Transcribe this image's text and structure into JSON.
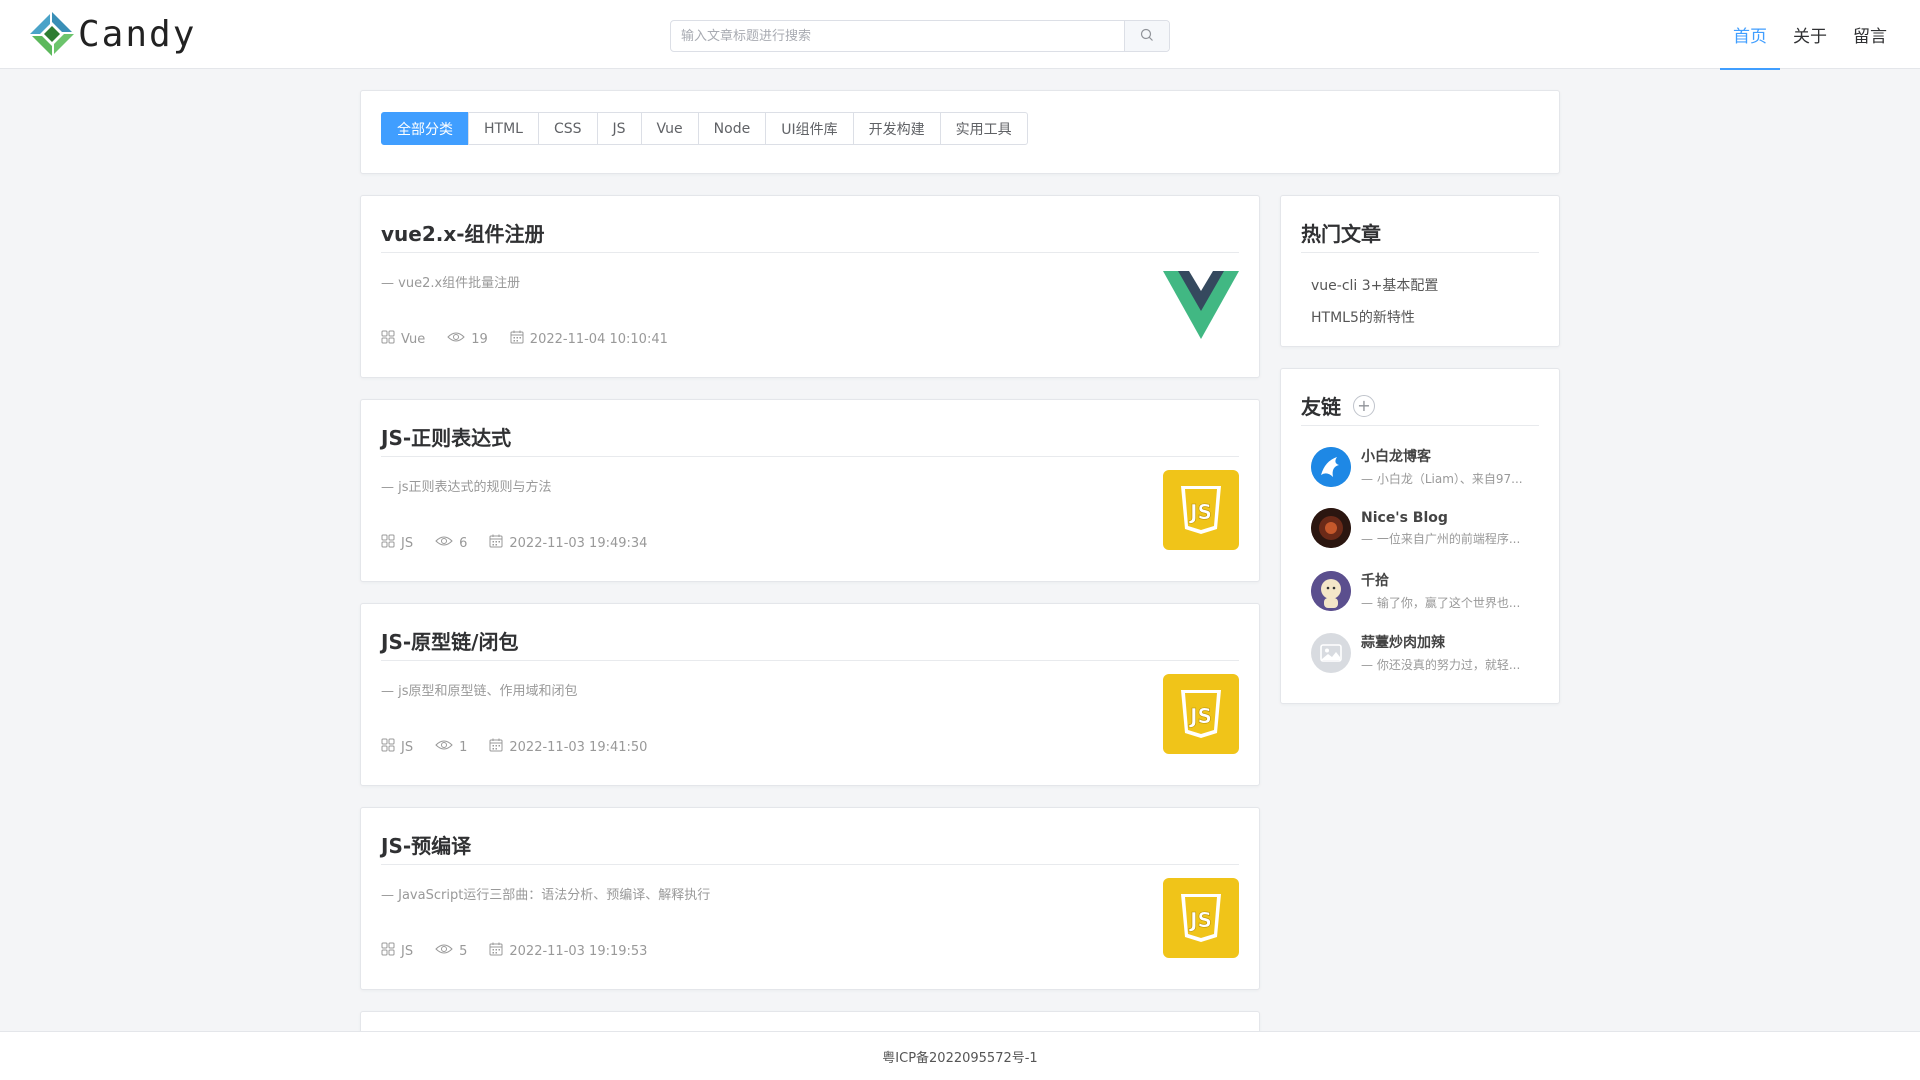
{
  "header": {
    "logo_text": "Candy",
    "search_placeholder": "输入文章标题进行搜索",
    "nav": [
      "首页",
      "关于",
      "留言"
    ]
  },
  "categories": [
    {
      "label": "全部分类",
      "active": true
    },
    {
      "label": "HTML"
    },
    {
      "label": "CSS"
    },
    {
      "label": "JS"
    },
    {
      "label": "Vue"
    },
    {
      "label": "Node"
    },
    {
      "label": "UI组件库"
    },
    {
      "label": "开发构建"
    },
    {
      "label": "实用工具"
    }
  ],
  "articles": [
    {
      "title": "vue2.x-组件注册",
      "desc": "— vue2.x组件批量注册",
      "category": "Vue",
      "views": "19",
      "date": "2022-11-04 10:10:41",
      "thumb": "vue-logo-icon"
    },
    {
      "title": "JS-正则表达式",
      "desc": "— js正则表达式的规则与方法",
      "category": "JS",
      "views": "6",
      "date": "2022-11-03 19:49:34",
      "thumb": "js-logo-icon"
    },
    {
      "title": "JS-原型链/闭包",
      "desc": "— js原型和原型链、作用域和闭包",
      "category": "JS",
      "views": "1",
      "date": "2022-11-03 19:41:50",
      "thumb": "js-logo-icon"
    },
    {
      "title": "JS-预编译",
      "desc": "— JavaScript运行三部曲：语法分析、预编译、解释执行",
      "category": "JS",
      "views": "5",
      "date": "2022-11-03 19:19:53",
      "thumb": "js-logo-icon"
    }
  ],
  "hot": {
    "title": "热门文章",
    "items": [
      "vue-cli 3+基本配置",
      "HTML5的新特性"
    ]
  },
  "friends": {
    "title": "友链",
    "plus": "+",
    "items": [
      {
        "name": "小白龙博客",
        "desc": "— 小白龙（Liam）、来自97..."
      },
      {
        "name": "Nice's Blog",
        "desc": "— 一位来自广州的前端程序..."
      },
      {
        "name": "千拾",
        "desc": "— 输了你，赢了这个世界也..."
      },
      {
        "name": "蒜薹炒肉加辣",
        "desc": "— 你还没真的努力过，就轻..."
      }
    ]
  },
  "footer": {
    "icp": "粤ICP备2022095572号-1"
  },
  "colors": {
    "accent": "#409eff",
    "js_yellow": "#f0c419",
    "vue_green": "#41b883",
    "vue_dark": "#35495e"
  }
}
